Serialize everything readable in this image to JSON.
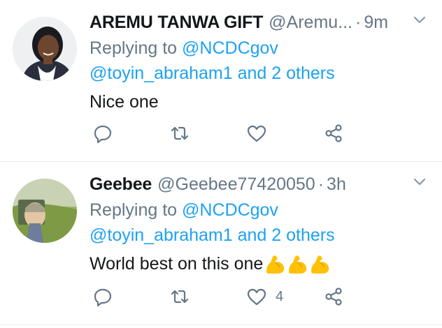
{
  "tweets": [
    {
      "name": "AREMU TANWA GIFT",
      "handle": "@Aremu...",
      "dot": "·",
      "time": "9m",
      "replying_prefix": "Replying to ",
      "replying_to": "@NCDCgov",
      "others": "@toyin_abraham1 and 2 others",
      "text": "Nice one",
      "like_count": ""
    },
    {
      "name": "Geebee",
      "handle": "@Geebee77420050",
      "dot": "·",
      "time": "3h",
      "replying_prefix": "Replying to ",
      "replying_to": "@NCDCgov",
      "others": "@toyin_abraham1 and 2 others",
      "text": "World best on this one",
      "emojis": [
        "flexed-biceps",
        "flexed-biceps",
        "flexed-biceps"
      ],
      "like_count": "4"
    }
  ],
  "colors": {
    "link": "#1da1f2",
    "muted": "#657786",
    "text": "#14171a",
    "divider": "#e6ecf0"
  }
}
